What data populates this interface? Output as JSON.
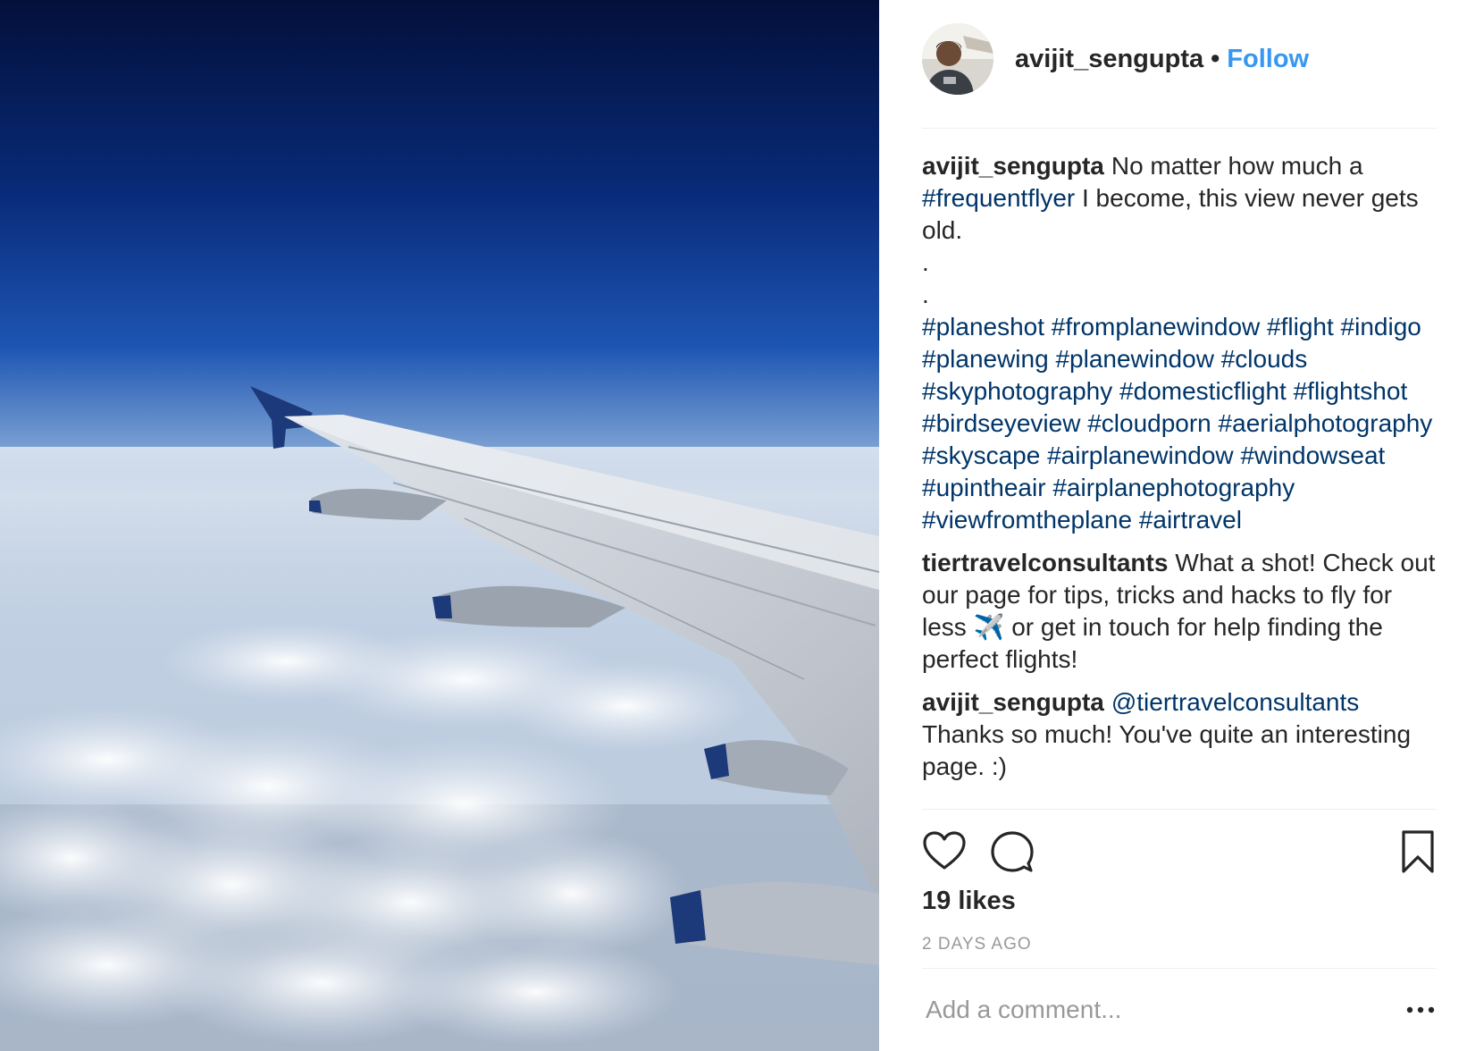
{
  "post": {
    "image_alt": "View of airplane wing over clouds"
  },
  "header": {
    "username": "avijit_sengupta",
    "separator": "•",
    "follow_label": "Follow"
  },
  "caption": {
    "author": "avijit_sengupta",
    "text_1": "No matter how much a",
    "tag_1": "#frequentflyer",
    "text_2": " I become, this view never gets old.",
    "dot_1": ".",
    "dot_2": ".",
    "hashtags": [
      "#planeshot",
      "#fromplanewindow",
      "#flight",
      "#indigo",
      "#planewing",
      "#planewindow",
      "#clouds",
      "#skyphotography",
      "#domesticflight",
      "#flightshot",
      "#birdseyeview",
      "#cloudporn",
      "#aerialphotography",
      "#skyscape",
      "#airplanewindow",
      "#windowseat",
      "#upintheair",
      "#airplanephotography",
      "#viewfromtheplane",
      "#airtravel"
    ]
  },
  "comments": [
    {
      "author": "tiertravelconsultants",
      "text": "What a shot! Check out our page for tips, tricks and hacks to fly for less ✈️ or get in touch for help finding the perfect flights!"
    },
    {
      "author": "avijit_sengupta",
      "mention": "@tiertravelconsultants",
      "text": "Thanks so much! You've quite an interesting page. :)"
    }
  ],
  "actions": {
    "like_icon": "heart-outline-icon",
    "comment_icon": "speech-bubble-icon",
    "save_icon": "bookmark-outline-icon"
  },
  "likes_text": "19 likes",
  "timestamp": "2 DAYS AGO",
  "comment_input": {
    "placeholder": "Add a comment..."
  },
  "more_icon": "ellipsis-icon",
  "colors": {
    "link": "#3897f0",
    "hashtag": "#003569",
    "muted": "#999999",
    "text": "#262626"
  }
}
